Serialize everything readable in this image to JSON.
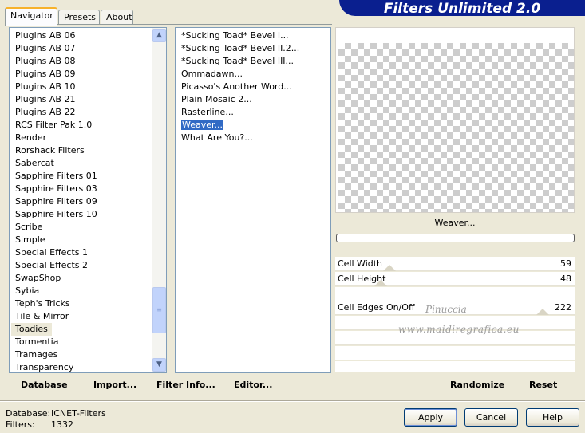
{
  "app": {
    "banner_title": "Filters Unlimited 2.0"
  },
  "tabs": [
    {
      "label": "Navigator",
      "active": true
    },
    {
      "label": "Presets",
      "active": false
    },
    {
      "label": "About",
      "active": false
    }
  ],
  "categories": {
    "items": [
      "Plugins AB 06",
      "Plugins AB 07",
      "Plugins AB 08",
      "Plugins AB 09",
      "Plugins AB 10",
      "Plugins AB 21",
      "Plugins AB 22",
      "RCS Filter Pak 1.0",
      "Render",
      "Rorshack Filters",
      "Sabercat",
      "Sapphire Filters 01",
      "Sapphire Filters 03",
      "Sapphire Filters 09",
      "Sapphire Filters 10",
      "Scribe",
      "Simple",
      "Special Effects 1",
      "Special Effects 2",
      "SwapShop",
      "Sybia",
      "Teph's Tricks",
      "Tile & Mirror",
      "Toadies",
      "Tormentia",
      "Tramages",
      "Transparency"
    ],
    "selected": "Toadies"
  },
  "filters": {
    "items": [
      "*Sucking Toad*  Bevel I...",
      "*Sucking Toad*  Bevel II.2...",
      "*Sucking Toad*  Bevel III...",
      "Ommadawn...",
      "Picasso's Another Word...",
      "Plain Mosaic 2...",
      "Rasterline...",
      "Weaver...",
      "What Are You?..."
    ],
    "selected": "Weaver..."
  },
  "preview": {
    "filter_name": "Weaver..."
  },
  "parameters": [
    {
      "label": "Cell Width",
      "value": "59"
    },
    {
      "label": "Cell Height",
      "value": "48"
    },
    {
      "label": "",
      "value": ""
    },
    {
      "label": "Cell Edges On/Off",
      "value": "222"
    }
  ],
  "watermark": {
    "line1": "Pinuccia",
    "line2": "www.maidiregrafica.eu"
  },
  "toolbar_left": {
    "database": "Database",
    "import": "Import...",
    "filter_info": "Filter Info...",
    "editor": "Editor..."
  },
  "toolbar_right": {
    "randomize": "Randomize",
    "reset": "Reset"
  },
  "status": {
    "database_label": "Database:",
    "database_value": "ICNET-Filters",
    "filters_label": "Filters:",
    "filters_value": "1332"
  },
  "buttons": {
    "apply": "Apply",
    "cancel": "Cancel",
    "help": "Help"
  },
  "icons": {
    "scroll_up": "chevron-up-icon",
    "scroll_down": "chevron-down-icon"
  }
}
